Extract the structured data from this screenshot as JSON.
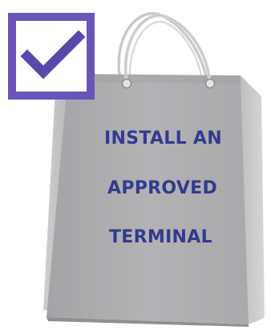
{
  "message": {
    "lines": [
      "INSTALL AN",
      "APPROVED",
      "TERMINAL"
    ]
  },
  "checkbox": {
    "icon": "checkmark-icon",
    "checked": true
  },
  "bag": {
    "icon": "shopping-bag-icon"
  },
  "colors": {
    "text": "#343a8c",
    "checkbox_border": "#6a54b8",
    "checkmark": "#5b48ad",
    "bag_front": "#adadb0",
    "bag_side": "#c8c8cb",
    "handle": "#d2d2d4"
  }
}
